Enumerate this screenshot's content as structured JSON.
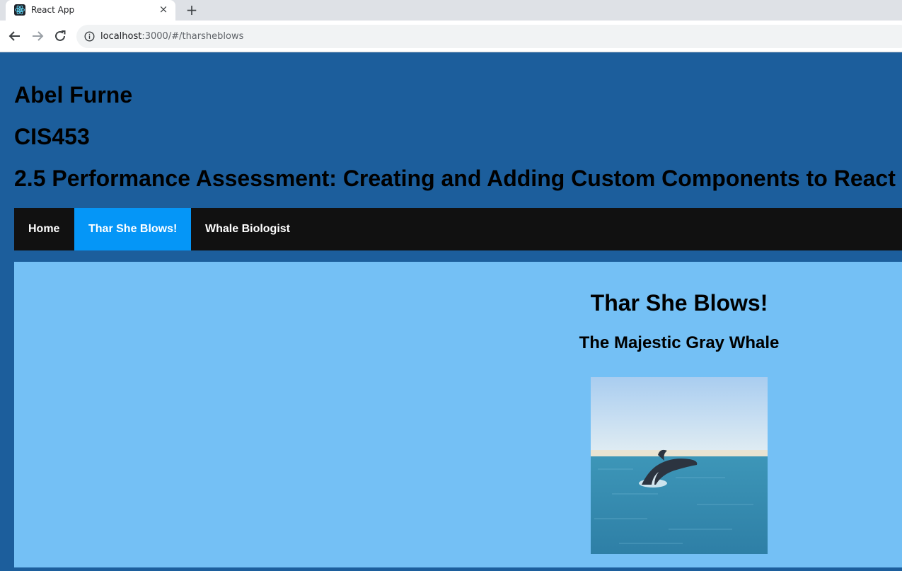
{
  "browser": {
    "tab_title": "React App",
    "close_glyph": "×",
    "new_tab_glyph": "+",
    "url_host": "localhost",
    "url_rest": ":3000/#/tharsheblows",
    "icons": [
      "react-favicon-icon",
      "back-arrow-icon",
      "forward-arrow-icon",
      "reload-icon",
      "info-icon"
    ]
  },
  "header": {
    "name": "Abel Furne",
    "course": "CIS453",
    "assignment": "2.5 Performance Assessment: Creating and Adding Custom Components to React"
  },
  "nav": {
    "items": [
      {
        "label": "Home",
        "active": false
      },
      {
        "label": "Thar She Blows!",
        "active": true
      },
      {
        "label": "Whale Biologist",
        "active": false
      }
    ]
  },
  "content": {
    "title": "Thar She Blows!",
    "subtitle": "The Majestic Gray Whale",
    "image": "gray-whale-breaching-photo"
  },
  "colors": {
    "page_bg": "#1c5e9c",
    "nav_bg": "#111111",
    "nav_active": "#0596f7",
    "content_bg": "#74c0f5"
  }
}
